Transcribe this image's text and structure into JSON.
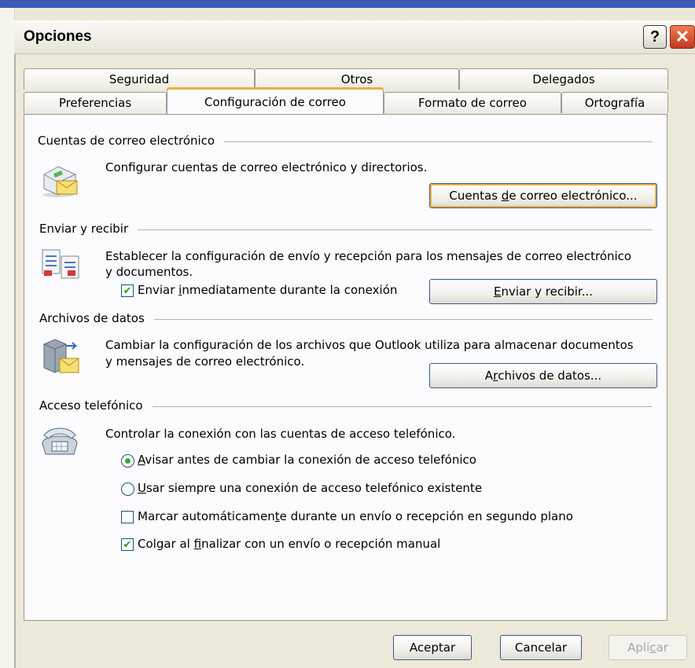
{
  "dialog": {
    "title": "Opciones",
    "help_label": "?",
    "close_label": "✕"
  },
  "tabs": {
    "row1": [
      "Seguridad",
      "Otros",
      "Delegados"
    ],
    "row2": [
      "Preferencias",
      "Configuración de correo",
      "Formato de correo",
      "Ortografía"
    ],
    "active": "Configuración de correo"
  },
  "sections": {
    "accounts": {
      "title": "Cuentas de correo electrónico",
      "description": "Configurar cuentas de correo electrónico y directorios.",
      "button_pre": "Cuentas ",
      "button_key": "d",
      "button_post": "e correo electrónico...",
      "icon": "mail-accounts-icon"
    },
    "send_receive": {
      "title": "Enviar y recibir",
      "description_line1": "Establecer la configuración de envío y recepción para los mensajes de correo electrónico",
      "description_line2": "y documentos.",
      "checkbox_pre": "Enviar ",
      "checkbox_key": "i",
      "checkbox_post": "nmediatamente durante la conexión",
      "checkbox_checked": true,
      "button_key": "E",
      "button_post": "nviar y recibir...",
      "icon": "send-receive-icon"
    },
    "data_files": {
      "title": "Archivos de datos",
      "description_line1": "Cambiar la configuración de los archivos que Outlook utiliza para almacenar documentos",
      "description_line2": "y mensajes de correo electrónico.",
      "button_pre": "A",
      "button_key": "r",
      "button_post": "chivos de datos...",
      "icon": "data-files-icon"
    },
    "dialup": {
      "title": "Acceso telefónico",
      "description": "Controlar la conexión con las cuentas de acceso telefónico.",
      "icon": "phone-icon",
      "radio1_key": "A",
      "radio1_post": "visar antes de cambiar la conexión de acceso telefónico",
      "radio1_selected": true,
      "radio2_key": "U",
      "radio2_post": "sar siempre una conexión de acceso telefónico existente",
      "radio2_selected": false,
      "check1_pre": "Marcar automáticamen",
      "check1_key": "t",
      "check1_post": "e durante un envío o recepción en segundo plano",
      "check1_checked": false,
      "check2_pre": "Colgar al ",
      "check2_key": "f",
      "check2_post": "inalizar con un envío o recepción manual",
      "check2_checked": true
    }
  },
  "footer": {
    "ok": "Aceptar",
    "cancel": "Cancelar",
    "apply_pre": "Apli",
    "apply_key": "c",
    "apply_post": "ar"
  },
  "colors": {
    "tab_active_accent": "#f2ad3d",
    "check_mark": "#21a121",
    "title_close": "#c23a1f"
  }
}
